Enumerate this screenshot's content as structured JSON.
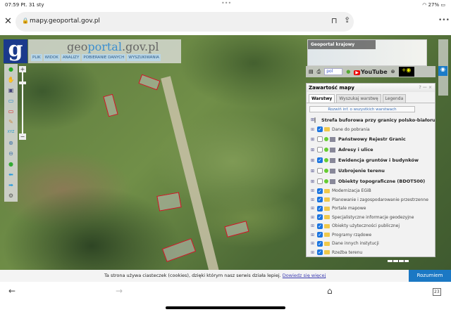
{
  "status": {
    "time": "07:59",
    "date": "Pt. 31 sty",
    "battery": "27%"
  },
  "browser": {
    "url": "mapy.geoportal.gov.pl",
    "tabs_count": "23"
  },
  "header": {
    "logo_letter": "g",
    "brand_geo": "geo",
    "brand_portal": "portal",
    "brand_domain": ".gov.pl",
    "menu": [
      "PLIK",
      "WIDOK",
      "ANALIZY",
      "POBIERANIE DANYCH",
      "WYSZUKIWANIA"
    ]
  },
  "minimap": {
    "label": "Geoportal krajowy"
  },
  "toolbar": {
    "language": "pol",
    "youtube": "YouTube"
  },
  "panel": {
    "title": "Zawartość mapy",
    "controls": "? — ×",
    "tabs": [
      "Warstwy",
      "Wyszukaj warstwę",
      "Legenda"
    ],
    "expand_all": "Rozwiń inf. o wszystkich warstwach",
    "layers": [
      {
        "label": "Strefa buforowa przy granicy polsko-białoruskiej",
        "checked": false,
        "type": "layer"
      },
      {
        "label": "Dane do pobrania",
        "checked": true,
        "type": "folder"
      },
      {
        "label": "Państwowy Rejestr Granic",
        "checked": false,
        "type": "layer"
      },
      {
        "label": "Adresy i ulice",
        "checked": false,
        "type": "layer"
      },
      {
        "label": "Ewidencja gruntów i budynków",
        "checked": true,
        "type": "layer"
      },
      {
        "label": "Uzbrojenie terenu",
        "checked": false,
        "type": "layer"
      },
      {
        "label": "Obiekty topograficzne (BDOT500)",
        "checked": false,
        "type": "layer"
      },
      {
        "label": "Modernizacja EGiB",
        "checked": true,
        "type": "folder"
      },
      {
        "label": "Planowanie i zagospodarowanie przestrzenne",
        "checked": true,
        "type": "folder"
      },
      {
        "label": "Portale mapowe",
        "checked": true,
        "type": "folder"
      },
      {
        "label": "Specjalistyczne informacje geodezyjne",
        "checked": true,
        "type": "folder"
      },
      {
        "label": "Obiekty użyteczności publicznej",
        "checked": true,
        "type": "folder"
      },
      {
        "label": "Programy rządowe",
        "checked": true,
        "type": "folder"
      },
      {
        "label": "Dane innych instytucji",
        "checked": true,
        "type": "folder"
      },
      {
        "label": "Rzeźba terenu",
        "checked": true,
        "type": "folder"
      }
    ]
  },
  "cookie": {
    "text": "Ta strona używa ciasteczek (cookies), dzięki którym nasz serwis działa lepiej.",
    "link": "Dowiedz się więcej",
    "accept": "Rozumiem"
  }
}
